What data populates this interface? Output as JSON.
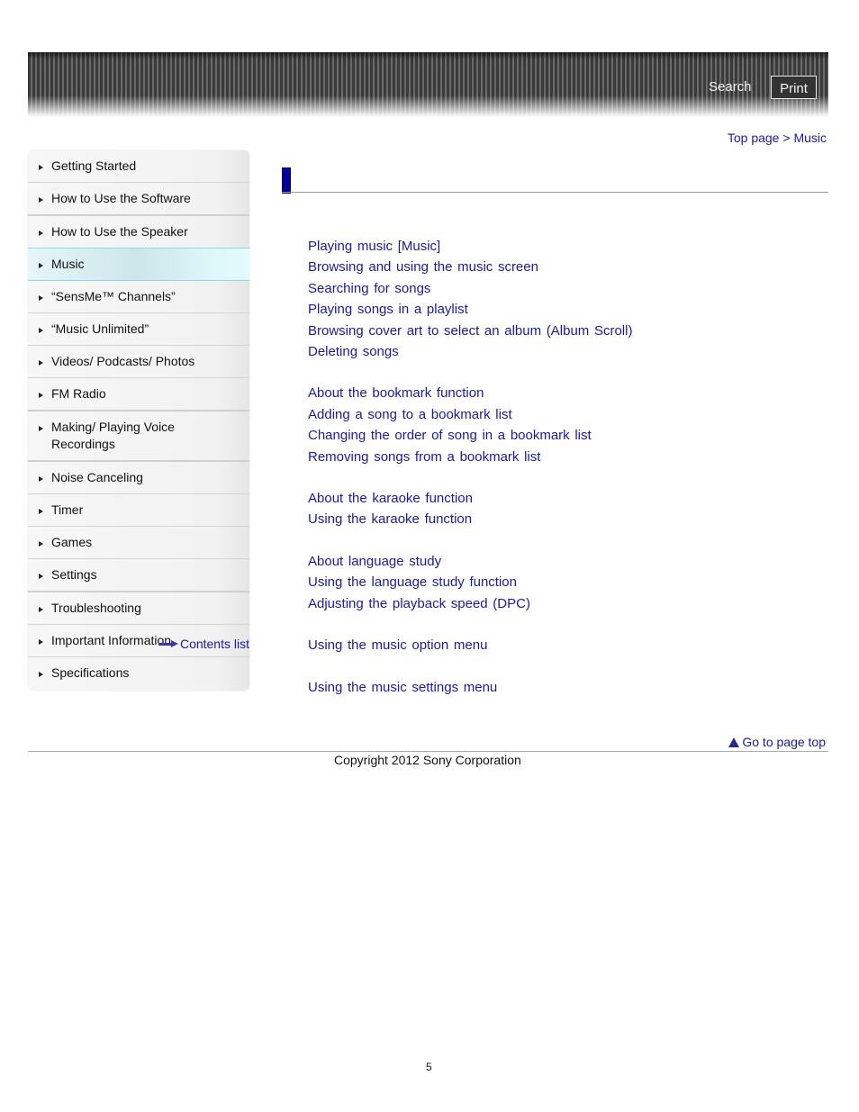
{
  "header": {
    "search_label": "Search",
    "print_label": "Print"
  },
  "breadcrumb": {
    "top_page": "Top page",
    "separator": ">",
    "current": "Music"
  },
  "sidebar": {
    "items": [
      {
        "label": "Getting Started",
        "active": false
      },
      {
        "label": "How to Use the Software",
        "active": false
      },
      {
        "label": "How to Use the Speaker",
        "active": false
      },
      {
        "label": "Music",
        "active": true
      },
      {
        "label": "“SensMe™ Channels”",
        "active": false
      },
      {
        "label": "“Music Unlimited”",
        "active": false
      },
      {
        "label": "Videos/ Podcasts/ Photos",
        "active": false
      },
      {
        "label": "FM Radio",
        "active": false
      },
      {
        "label": "Making/ Playing Voice Recordings",
        "active": false
      },
      {
        "label": "Noise Canceling",
        "active": false
      },
      {
        "label": "Timer",
        "active": false
      },
      {
        "label": "Games",
        "active": false
      },
      {
        "label": "Settings",
        "active": false
      },
      {
        "label": "Troubleshooting",
        "active": false
      },
      {
        "label": "Important Information",
        "active": false
      },
      {
        "label": "Specifications",
        "active": false
      }
    ],
    "contents_list_label": "Contents list"
  },
  "main": {
    "title": "",
    "groups": [
      {
        "links": [
          "Playing music [Music]",
          "Browsing and using the music screen",
          "Searching for songs",
          "Playing songs in a playlist",
          "Browsing cover art to select an album (Album Scroll)",
          "Deleting songs"
        ]
      },
      {
        "links": [
          "About the bookmark function",
          "Adding a song to a bookmark list",
          "Changing the order of song in a bookmark list",
          "Removing songs from a bookmark list"
        ]
      },
      {
        "links": [
          "About the karaoke function",
          "Using the karaoke function"
        ]
      },
      {
        "links": [
          "About language study",
          "Using the language study function",
          "Adjusting the playback speed (DPC)"
        ]
      },
      {
        "links": [
          "Using the music option menu"
        ]
      },
      {
        "links": [
          "Using the music settings menu"
        ]
      }
    ]
  },
  "footer": {
    "go_to_top_label": "Go to page top",
    "copyright": "Copyright 2012 Sony Corporation",
    "page_number": "5"
  },
  "colors": {
    "link": "#1a1aa6",
    "title_accent": "#000099",
    "active_nav": "#cde6ea"
  }
}
